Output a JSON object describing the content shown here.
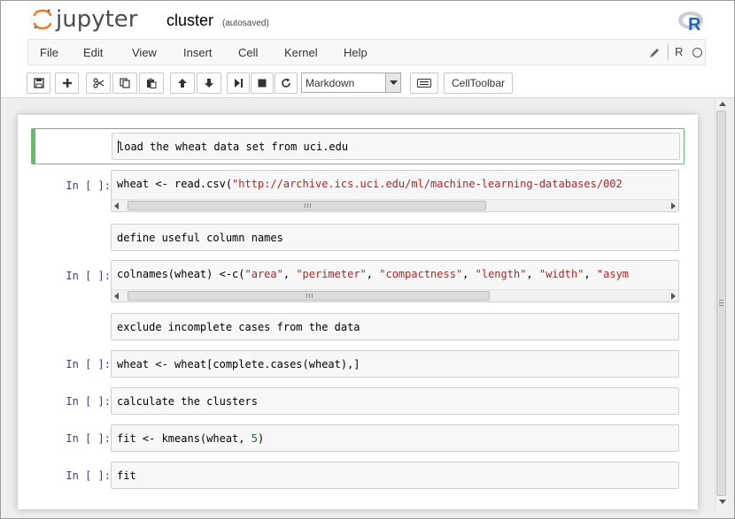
{
  "header": {
    "app_name": "jupyter",
    "notebook_name": "cluster",
    "autosave_status": "(autosaved)",
    "kernel_logo": "R"
  },
  "menubar": {
    "items": [
      "File",
      "Edit",
      "View",
      "Insert",
      "Cell",
      "Kernel",
      "Help"
    ],
    "kernel_name": "R"
  },
  "toolbar": {
    "buttons": [
      "save-icon",
      "plus-icon",
      "scissors-icon",
      "copy-icon",
      "paste-icon",
      "arrow-up-icon",
      "arrow-down-icon",
      "step-forward-icon",
      "stop-icon",
      "restart-icon"
    ],
    "cell_type": "Markdown",
    "keyboard_icon": "keyboard-icon",
    "celltoolbar_label": "CellToolbar"
  },
  "cells": [
    {
      "type": "markdown",
      "prompt": "",
      "text": "load the wheat data set from uci.edu"
    },
    {
      "type": "code",
      "prompt": "In [ ]:",
      "code_pre": "wheat <- read.csv(",
      "code_str": "\"http://archive.ics.uci.edu/ml/machine-learning-databases/002",
      "code_post": ""
    },
    {
      "type": "markdown",
      "prompt": "",
      "text": "define useful column names"
    },
    {
      "type": "code",
      "prompt": "In [ ]:",
      "code_pre": "colnames(wheat) <-c(",
      "s1": "\"area\"",
      "s2": "\"perimeter\"",
      "s3": "\"compactness\"",
      "s4": "\"length\"",
      "s5": "\"width\"",
      "s6": "\"asym"
    },
    {
      "type": "markdown",
      "prompt": "",
      "text": "exclude incomplete cases from the data"
    },
    {
      "type": "code",
      "prompt": "In [ ]:",
      "text": "wheat <- wheat[complete.cases(wheat),]"
    },
    {
      "type": "code",
      "prompt": "In [ ]:",
      "text": "calculate the clusters"
    },
    {
      "type": "code",
      "prompt": "In [ ]:",
      "code_pre": "fit <- kmeans(wheat, ",
      "code_num": "5",
      "code_post": ")"
    },
    {
      "type": "code",
      "prompt": "In [ ]:",
      "text": "fit"
    }
  ],
  "colors": {
    "prompt": "#303f9f",
    "string": "#ba2121",
    "number": "#008000",
    "selected_border": "#66bb6a"
  }
}
